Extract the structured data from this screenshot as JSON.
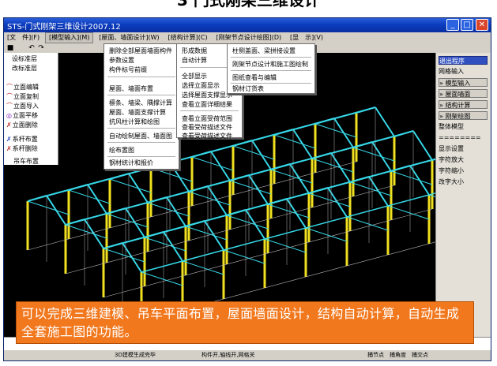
{
  "slide_title": "3 门式刚架三维设计",
  "window": {
    "title": "STS-门式刚架三维设计2007.12",
    "buttons": [
      "_",
      "□",
      "✕"
    ]
  },
  "menu": [
    "[文　件](F)",
    "[模型输入](M)",
    "[屋面、墙面设计](W)",
    "[结构计算](C)",
    "[刚架节点设计绘图](D)",
    "[显　示](V)"
  ],
  "left_panel": [
    {
      "icon": "",
      "label": "设标准层"
    },
    {
      "icon": "",
      "label": "改标准层"
    },
    {
      "icon": "⌒",
      "label": "立面编辑"
    },
    {
      "icon": "⌒",
      "label": "立面复制"
    },
    {
      "icon": "⌒",
      "label": "立面导入"
    },
    {
      "icon": "◎",
      "label": "立面平移"
    },
    {
      "icon": "✗",
      "label": "立面删除"
    },
    {
      "icon": "✗",
      "label": "系杆布置"
    },
    {
      "icon": "✗",
      "label": "系杆删除"
    },
    {
      "icon": "",
      "label": "吊车布置"
    }
  ],
  "dropdown_roof": {
    "items": [
      "删除全部屋面墙面构件",
      "参数设置",
      "构件标号前缀",
      "屋面、墙面布置",
      "檩条、墙梁、隅撑计算",
      "屋面、墙面支撑计算",
      "抗风柱计算和绘图",
      "自动绘制屋面、墙面图",
      "绘布置图",
      "钢材统计和报价"
    ]
  },
  "dropdown_calc": {
    "items": [
      "形成数据",
      "自动计算",
      "全部显示",
      "选择立面显示",
      "选择屋面支撑显示",
      "查看立面详细结果",
      "查看立面受荷范围",
      "查看受荷描述文件",
      "查看受荷描述文件"
    ]
  },
  "dropdown_draw": {
    "items": [
      "柱侧盖面、梁拼接设置",
      "刚架节点设计和施工图绘制",
      "图纸查看与编辑",
      "钢材订货表"
    ]
  },
  "right_panel": [
    {
      "label": "退出程序",
      "style": "hl"
    },
    {
      "label": "网格输入",
      "style": "plain"
    },
    {
      "label": "» 模型输入",
      "style": "btn"
    },
    {
      "label": "» 屋面墙面",
      "style": "btn"
    },
    {
      "label": "» 结构计算",
      "style": "btn"
    },
    {
      "label": "» 刚架绘图",
      "style": "btn"
    },
    {
      "label": "整体模型",
      "style": "plain"
    },
    {
      "label": "========",
      "style": "plain"
    },
    {
      "label": "显示设置",
      "style": "plain"
    },
    {
      "label": "字符放大",
      "style": "plain"
    },
    {
      "label": "字符缩小",
      "style": "plain"
    },
    {
      "label": "改字大小",
      "style": "plain"
    }
  ],
  "status": {
    "left": "3D建模生成完毕",
    "middle": "构件开,轴线开,网格关",
    "snap1": "捕节点",
    "snap2": "捕角度",
    "snap3": "捕交点"
  },
  "caption": "可以完成三维建模、吊车平面布置，屋面墙面设计，结构自动计算，自动生成全套施工图的功能。",
  "colors": {
    "frame_cyan": "#36d8e8",
    "column_yellow": "#f0e020",
    "caption_orange": "#f2781e",
    "titlebar_blue": "#0b3cc0"
  }
}
